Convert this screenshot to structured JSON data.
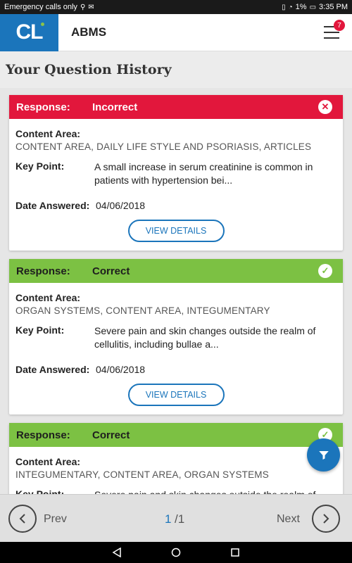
{
  "status_bar": {
    "left_text": "Emergency calls only",
    "battery": "1%",
    "time": "3:35 PM"
  },
  "app_bar": {
    "logo": "CL",
    "title": "ABMS",
    "notification_count": "7"
  },
  "page_title": "Your Question History",
  "labels": {
    "response": "Response:",
    "content_area": "Content Area:",
    "key_point": "Key Point:",
    "date_answered": "Date Answered:",
    "view_details": "VIEW DETAILS"
  },
  "cards": [
    {
      "status": "Incorrect",
      "content_area": "CONTENT AREA, DAILY LIFE STYLE AND PSORIASIS, ARTICLES",
      "key_point": "A small increase in serum creatinine is common in patients with hypertension bei...",
      "date": "04/06/2018"
    },
    {
      "status": "Correct",
      "content_area": "ORGAN SYSTEMS, CONTENT AREA, INTEGUMENTARY",
      "key_point": "Severe pain and skin changes outside the realm of cellulitis, including bullae a...",
      "date": "04/06/2018"
    },
    {
      "status": "Correct",
      "content_area": "INTEGUMENTARY, CONTENT AREA, ORGAN SYSTEMS",
      "key_point": "Severe pain and skin changes outside the realm of",
      "date": ""
    }
  ],
  "pager": {
    "prev": "Prev",
    "next": "Next",
    "current_page": "1",
    "total": "/1"
  },
  "colors": {
    "brand_blue": "#1b75bb",
    "incorrect_red": "#e2173c",
    "correct_green": "#7cc143"
  }
}
